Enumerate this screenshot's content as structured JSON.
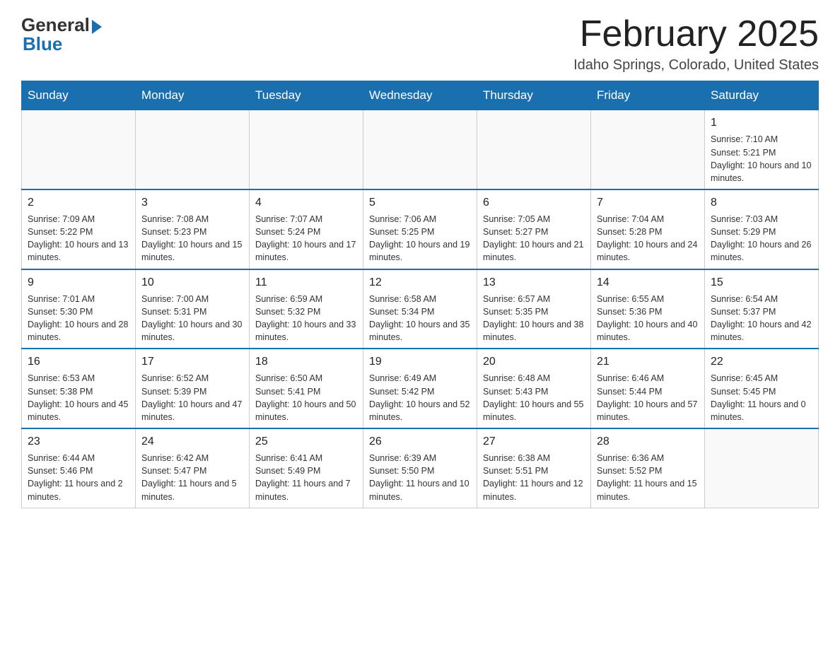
{
  "logo": {
    "general": "General",
    "blue": "Blue"
  },
  "title": "February 2025",
  "location": "Idaho Springs, Colorado, United States",
  "days_of_week": [
    "Sunday",
    "Monday",
    "Tuesday",
    "Wednesday",
    "Thursday",
    "Friday",
    "Saturday"
  ],
  "weeks": [
    [
      {
        "day": "",
        "info": ""
      },
      {
        "day": "",
        "info": ""
      },
      {
        "day": "",
        "info": ""
      },
      {
        "day": "",
        "info": ""
      },
      {
        "day": "",
        "info": ""
      },
      {
        "day": "",
        "info": ""
      },
      {
        "day": "1",
        "info": "Sunrise: 7:10 AM\nSunset: 5:21 PM\nDaylight: 10 hours and 10 minutes."
      }
    ],
    [
      {
        "day": "2",
        "info": "Sunrise: 7:09 AM\nSunset: 5:22 PM\nDaylight: 10 hours and 13 minutes."
      },
      {
        "day": "3",
        "info": "Sunrise: 7:08 AM\nSunset: 5:23 PM\nDaylight: 10 hours and 15 minutes."
      },
      {
        "day": "4",
        "info": "Sunrise: 7:07 AM\nSunset: 5:24 PM\nDaylight: 10 hours and 17 minutes."
      },
      {
        "day": "5",
        "info": "Sunrise: 7:06 AM\nSunset: 5:25 PM\nDaylight: 10 hours and 19 minutes."
      },
      {
        "day": "6",
        "info": "Sunrise: 7:05 AM\nSunset: 5:27 PM\nDaylight: 10 hours and 21 minutes."
      },
      {
        "day": "7",
        "info": "Sunrise: 7:04 AM\nSunset: 5:28 PM\nDaylight: 10 hours and 24 minutes."
      },
      {
        "day": "8",
        "info": "Sunrise: 7:03 AM\nSunset: 5:29 PM\nDaylight: 10 hours and 26 minutes."
      }
    ],
    [
      {
        "day": "9",
        "info": "Sunrise: 7:01 AM\nSunset: 5:30 PM\nDaylight: 10 hours and 28 minutes."
      },
      {
        "day": "10",
        "info": "Sunrise: 7:00 AM\nSunset: 5:31 PM\nDaylight: 10 hours and 30 minutes."
      },
      {
        "day": "11",
        "info": "Sunrise: 6:59 AM\nSunset: 5:32 PM\nDaylight: 10 hours and 33 minutes."
      },
      {
        "day": "12",
        "info": "Sunrise: 6:58 AM\nSunset: 5:34 PM\nDaylight: 10 hours and 35 minutes."
      },
      {
        "day": "13",
        "info": "Sunrise: 6:57 AM\nSunset: 5:35 PM\nDaylight: 10 hours and 38 minutes."
      },
      {
        "day": "14",
        "info": "Sunrise: 6:55 AM\nSunset: 5:36 PM\nDaylight: 10 hours and 40 minutes."
      },
      {
        "day": "15",
        "info": "Sunrise: 6:54 AM\nSunset: 5:37 PM\nDaylight: 10 hours and 42 minutes."
      }
    ],
    [
      {
        "day": "16",
        "info": "Sunrise: 6:53 AM\nSunset: 5:38 PM\nDaylight: 10 hours and 45 minutes."
      },
      {
        "day": "17",
        "info": "Sunrise: 6:52 AM\nSunset: 5:39 PM\nDaylight: 10 hours and 47 minutes."
      },
      {
        "day": "18",
        "info": "Sunrise: 6:50 AM\nSunset: 5:41 PM\nDaylight: 10 hours and 50 minutes."
      },
      {
        "day": "19",
        "info": "Sunrise: 6:49 AM\nSunset: 5:42 PM\nDaylight: 10 hours and 52 minutes."
      },
      {
        "day": "20",
        "info": "Sunrise: 6:48 AM\nSunset: 5:43 PM\nDaylight: 10 hours and 55 minutes."
      },
      {
        "day": "21",
        "info": "Sunrise: 6:46 AM\nSunset: 5:44 PM\nDaylight: 10 hours and 57 minutes."
      },
      {
        "day": "22",
        "info": "Sunrise: 6:45 AM\nSunset: 5:45 PM\nDaylight: 11 hours and 0 minutes."
      }
    ],
    [
      {
        "day": "23",
        "info": "Sunrise: 6:44 AM\nSunset: 5:46 PM\nDaylight: 11 hours and 2 minutes."
      },
      {
        "day": "24",
        "info": "Sunrise: 6:42 AM\nSunset: 5:47 PM\nDaylight: 11 hours and 5 minutes."
      },
      {
        "day": "25",
        "info": "Sunrise: 6:41 AM\nSunset: 5:49 PM\nDaylight: 11 hours and 7 minutes."
      },
      {
        "day": "26",
        "info": "Sunrise: 6:39 AM\nSunset: 5:50 PM\nDaylight: 11 hours and 10 minutes."
      },
      {
        "day": "27",
        "info": "Sunrise: 6:38 AM\nSunset: 5:51 PM\nDaylight: 11 hours and 12 minutes."
      },
      {
        "day": "28",
        "info": "Sunrise: 6:36 AM\nSunset: 5:52 PM\nDaylight: 11 hours and 15 minutes."
      },
      {
        "day": "",
        "info": ""
      }
    ]
  ]
}
